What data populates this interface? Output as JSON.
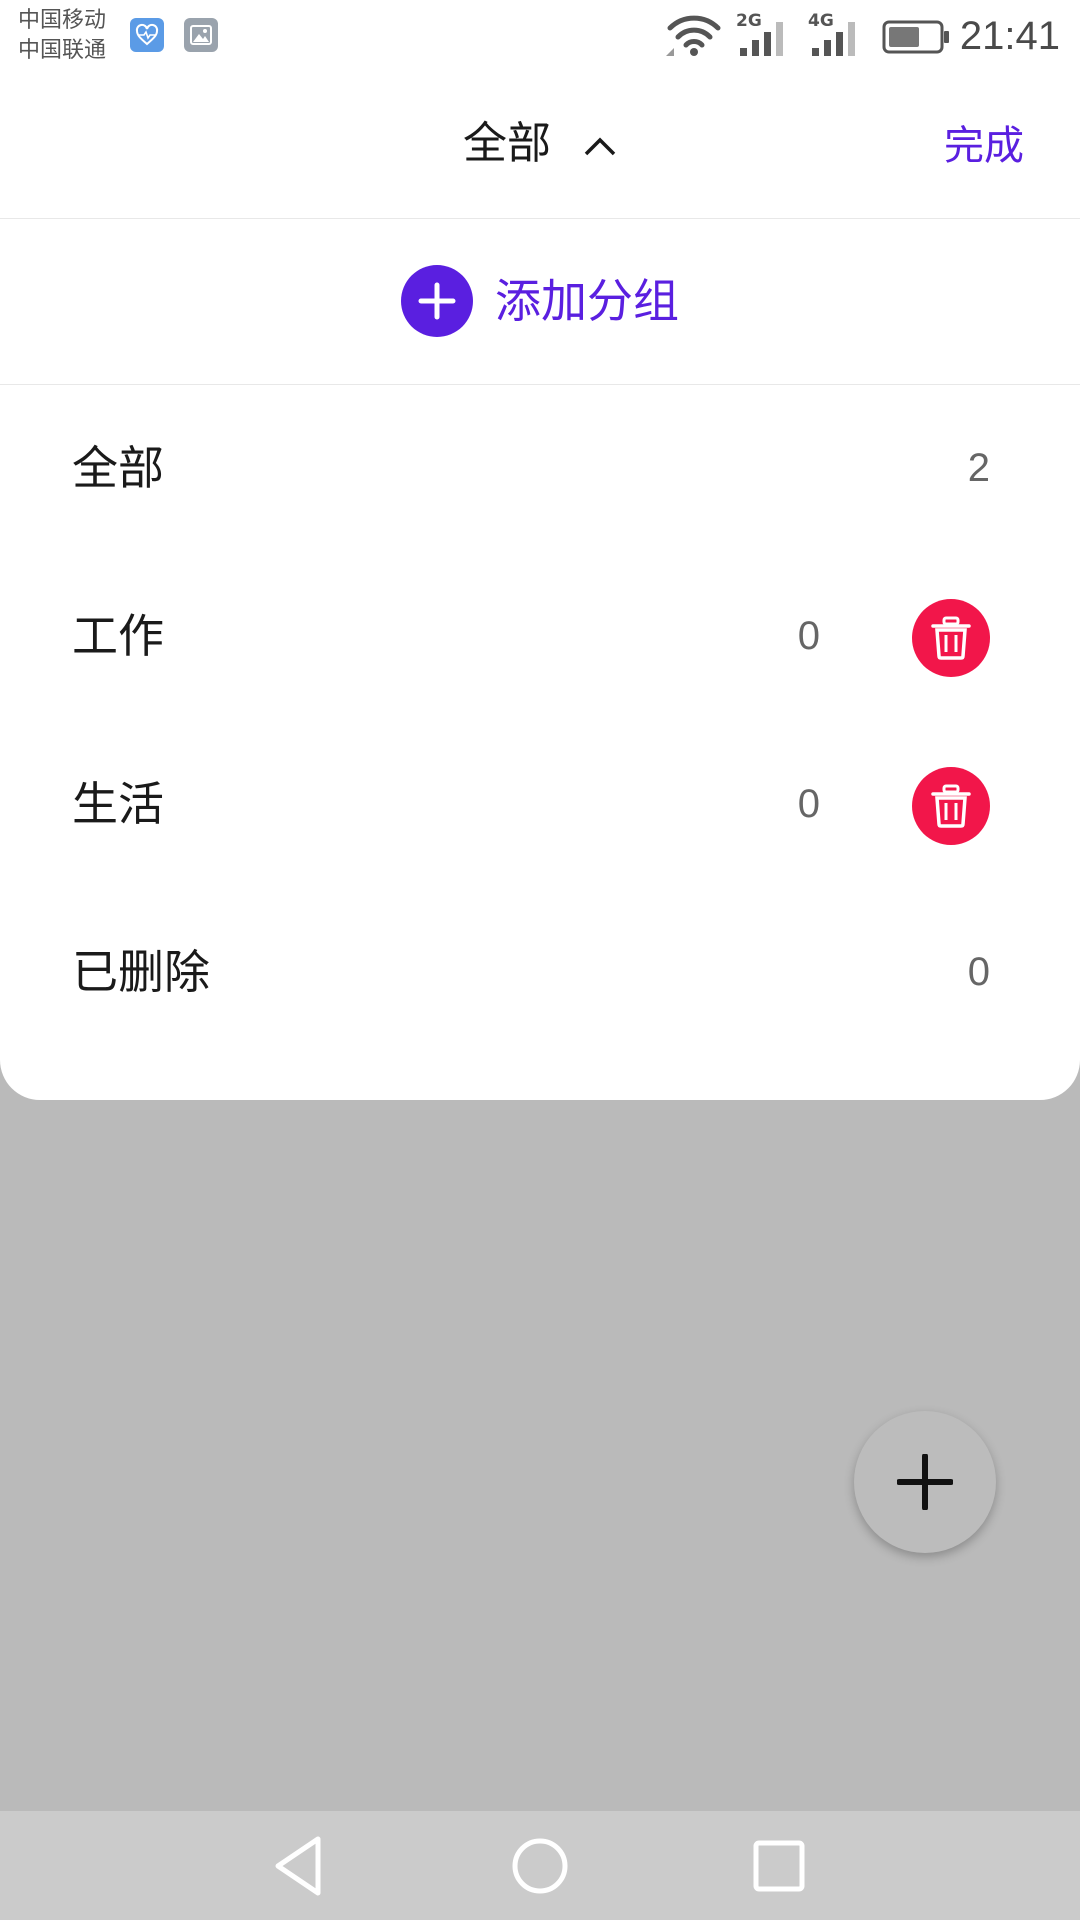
{
  "status_bar": {
    "carrier_1": "中国移动",
    "carrier_2": "中国联通",
    "network_1": "2G",
    "network_2": "4G",
    "time": "21:41",
    "notification_icons": [
      "health-icon",
      "gallery-icon"
    ]
  },
  "header": {
    "title": "全部",
    "title_icon": "chevron-up-icon",
    "done_label": "完成"
  },
  "add_group": {
    "label": "添加分组",
    "icon": "plus-circle-icon"
  },
  "groups": [
    {
      "name": "全部",
      "count": "2",
      "deletable": false
    },
    {
      "name": "工作",
      "count": "0",
      "deletable": true
    },
    {
      "name": "生活",
      "count": "0",
      "deletable": true
    },
    {
      "name": "已删除",
      "count": "0",
      "deletable": false
    }
  ],
  "fab": {
    "icon": "plus-icon"
  },
  "nav_bar": {
    "icons": [
      "back-triangle-icon",
      "home-circle-icon",
      "recent-square-icon"
    ]
  },
  "colors": {
    "accent": "#5a1fe0",
    "delete": "#f2164a",
    "overlay": "#bababa"
  }
}
